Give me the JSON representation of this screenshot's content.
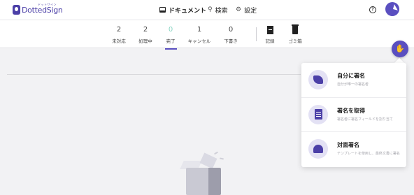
{
  "app": {
    "logo_text": "DottedSign",
    "logo_sub": "ドットサイン"
  },
  "nav": {
    "documents": "ドキュメント",
    "search": "検索",
    "settings": "設定",
    "help_icon": "help-circle",
    "avatar_icon": "paper-plane"
  },
  "status_tabs": [
    {
      "count": "2",
      "label": "未対応"
    },
    {
      "count": "2",
      "label": "処理中"
    },
    {
      "count": "0",
      "label": "完了",
      "active": true
    },
    {
      "count": "1",
      "label": "キャンセル"
    },
    {
      "count": "0",
      "label": "下書き"
    }
  ],
  "tools": {
    "records": "記録",
    "trash": "ゴミ箱"
  },
  "fab": {
    "icon": "hand-pointer"
  },
  "menu": [
    {
      "title": "自分に署名",
      "desc": "自分が唯一の署名者"
    },
    {
      "title": "署名を取得",
      "desc": "署名者に署名フィールドを割り当て"
    },
    {
      "title": "対面署名",
      "desc": "テンプレートを使用し、最終文書に署名"
    }
  ],
  "colors": {
    "brand": "#5a4fc0",
    "active_count": "#8ad6c3"
  }
}
